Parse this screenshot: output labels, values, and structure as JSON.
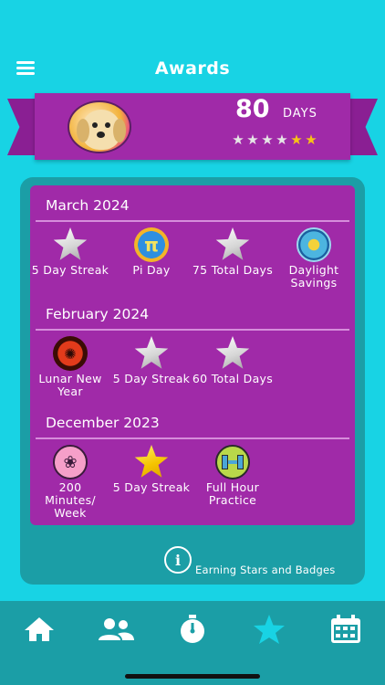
{
  "header": {
    "title": "Awards",
    "menu_icon": "hamburger-menu-icon"
  },
  "summary": {
    "days_count": "80",
    "days_label": "DAYS",
    "avatar_icon": "dog-avatar-icon",
    "stars": [
      "silver",
      "silver",
      "silver",
      "silver",
      "gold",
      "gold"
    ]
  },
  "sections": [
    {
      "heading": "March 2024",
      "badges": [
        {
          "label": "5 Day Streak",
          "icon": "silver-star-icon"
        },
        {
          "label": "Pi Day",
          "icon": "pi-icon"
        },
        {
          "label": "75 Total Days",
          "icon": "silver-star-icon"
        },
        {
          "label": "Daylight Savings",
          "icon": "sun-clock-icon"
        }
      ]
    },
    {
      "heading": "February 2024",
      "badges": [
        {
          "label": "Lunar New Year",
          "icon": "dragon-icon"
        },
        {
          "label": "5 Day Streak",
          "icon": "silver-star-icon"
        },
        {
          "label": "60 Total Days",
          "icon": "silver-star-icon"
        }
      ]
    },
    {
      "heading": "December 2023",
      "badges": [
        {
          "label": "200 Minutes/ Week",
          "icon": "paw-icon"
        },
        {
          "label": "5 Day Streak",
          "icon": "gold-star-icon"
        },
        {
          "label": "Full Hour Practice",
          "icon": "dumbbell-icon"
        }
      ]
    }
  ],
  "info_link": "Earning Stars and Badges",
  "tabs": [
    {
      "name": "home",
      "icon": "home-icon"
    },
    {
      "name": "people",
      "icon": "people-icon"
    },
    {
      "name": "timer",
      "icon": "stopwatch-icon"
    },
    {
      "name": "awards",
      "icon": "star-icon",
      "active": true
    },
    {
      "name": "calendar",
      "icon": "calendar-icon"
    }
  ],
  "colors": {
    "background": "#18d3e4",
    "banner": "#a02aa8",
    "panel": "#1b9ea6",
    "active_tab": "#18d3e4"
  }
}
